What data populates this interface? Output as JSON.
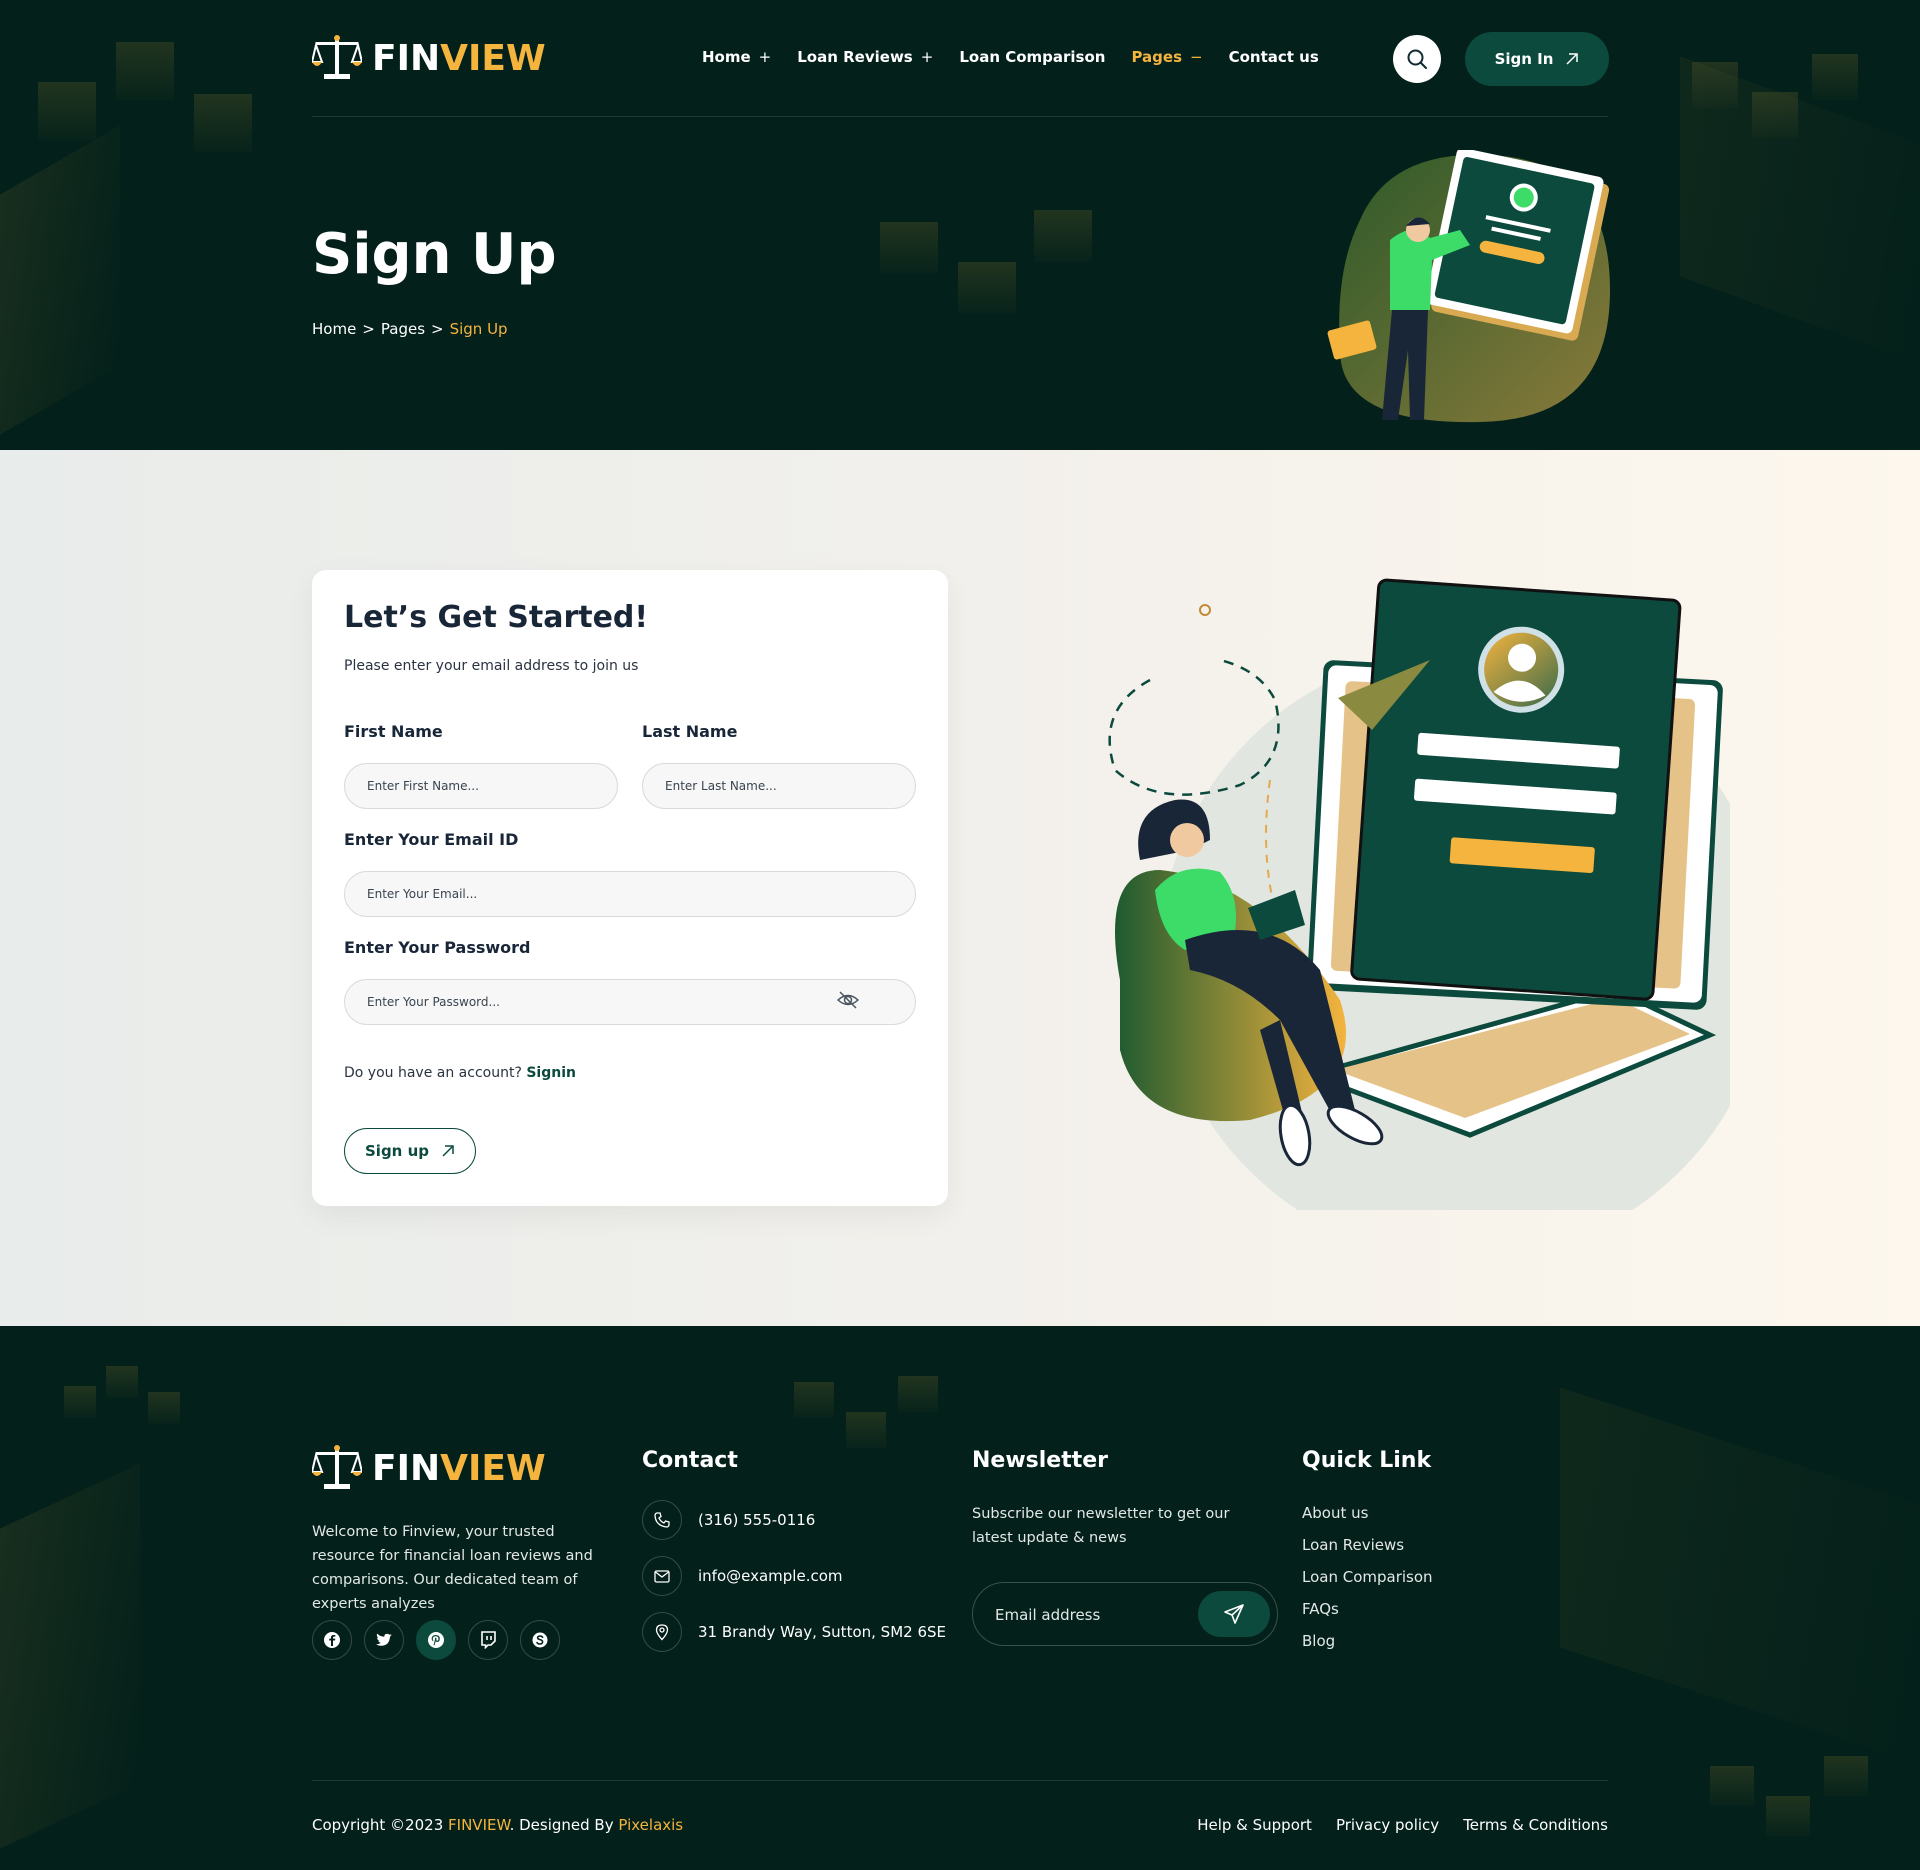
{
  "brand": {
    "part1": "FIN",
    "part2": "VIEW"
  },
  "nav": {
    "items": [
      {
        "label": "Home",
        "indicator": "+"
      },
      {
        "label": "Loan Reviews",
        "indicator": "+"
      },
      {
        "label": "Loan Comparison",
        "indicator": ""
      },
      {
        "label": "Pages",
        "indicator": "−"
      },
      {
        "label": "Contact us",
        "indicator": ""
      }
    ],
    "signin_label": "Sign In"
  },
  "hero": {
    "title": "Sign Up",
    "breadcrumb": [
      "Home",
      ">",
      "Pages",
      ">",
      "Sign Up"
    ]
  },
  "form": {
    "title": "Let’s Get Started!",
    "subtitle": "Please enter your email address to join us",
    "first_name_label": "First Name",
    "first_name_placeholder": "Enter First Name...",
    "last_name_label": "Last Name",
    "last_name_placeholder": "Enter Last Name...",
    "email_label": "Enter Your Email ID",
    "email_placeholder": "Enter Your Email...",
    "password_label": "Enter Your Password",
    "password_placeholder": "Enter Your Password...",
    "account_question": "Do you have an account?",
    "signin_link": "Signin",
    "submit_label": "Sign up"
  },
  "footer": {
    "about": "Welcome to Finview, your trusted resource for financial loan reviews and comparisons. Our dedicated team of experts analyzes",
    "socials": [
      "facebook-icon",
      "twitter-icon",
      "pinterest-icon",
      "twitch-icon",
      "skype-icon"
    ],
    "contact": {
      "heading": "Contact",
      "phone": "(316) 555-0116",
      "email": "info@example.com",
      "address": "31 Brandy Way, Sutton, SM2 6SE"
    },
    "newsletter": {
      "heading": "Newsletter",
      "text": "Subscribe our newsletter to get our latest update & news",
      "placeholder": "Email address"
    },
    "quick_links": {
      "heading": "Quick Link",
      "items": [
        "About us",
        "Loan Reviews",
        "Loan Comparison",
        "FAQs",
        "Blog"
      ]
    },
    "copyright_prefix": "Copyright ©2023",
    "copyright_brand": "FINVIEW",
    "designed_by": ". Designed By",
    "designer": "Pixelaxis",
    "legal": [
      "Help & Support",
      "Privacy policy",
      "Terms & Conditions"
    ]
  },
  "colors": {
    "dark": "#03201a",
    "accent": "#f4b43e",
    "primary": "#0c4a3e",
    "green": "#3ddc68"
  }
}
